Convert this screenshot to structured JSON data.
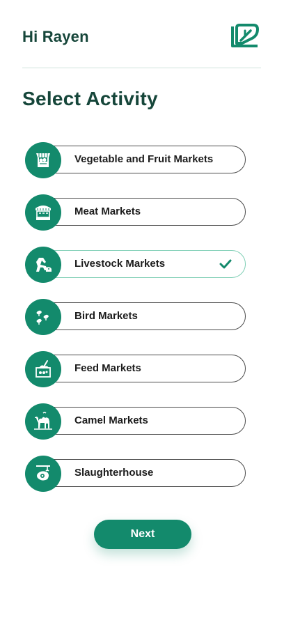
{
  "header": {
    "greeting": "Hi Rayen",
    "logo_icon": "leaf-logo-icon"
  },
  "title": "Select Activity",
  "activities": [
    {
      "label": "Vegetable and Fruit Markets",
      "icon": "vegetable-stall-icon",
      "selected": false
    },
    {
      "label": "Meat Markets",
      "icon": "meat-shop-icon",
      "selected": false
    },
    {
      "label": "Livestock Markets",
      "icon": "livestock-icon",
      "selected": true
    },
    {
      "label": "Bird Markets",
      "icon": "birds-icon",
      "selected": false
    },
    {
      "label": "Feed Markets",
      "icon": "feed-basket-icon",
      "selected": false
    },
    {
      "label": "Camel Markets",
      "icon": "camel-icon",
      "selected": false
    },
    {
      "label": "Slaughterhouse",
      "icon": "slaughterhouse-icon",
      "selected": false
    }
  ],
  "next_label": "Next",
  "colors": {
    "primary": "#138a6c",
    "heading": "#16463a",
    "selected_border": "#7fcfb5"
  }
}
